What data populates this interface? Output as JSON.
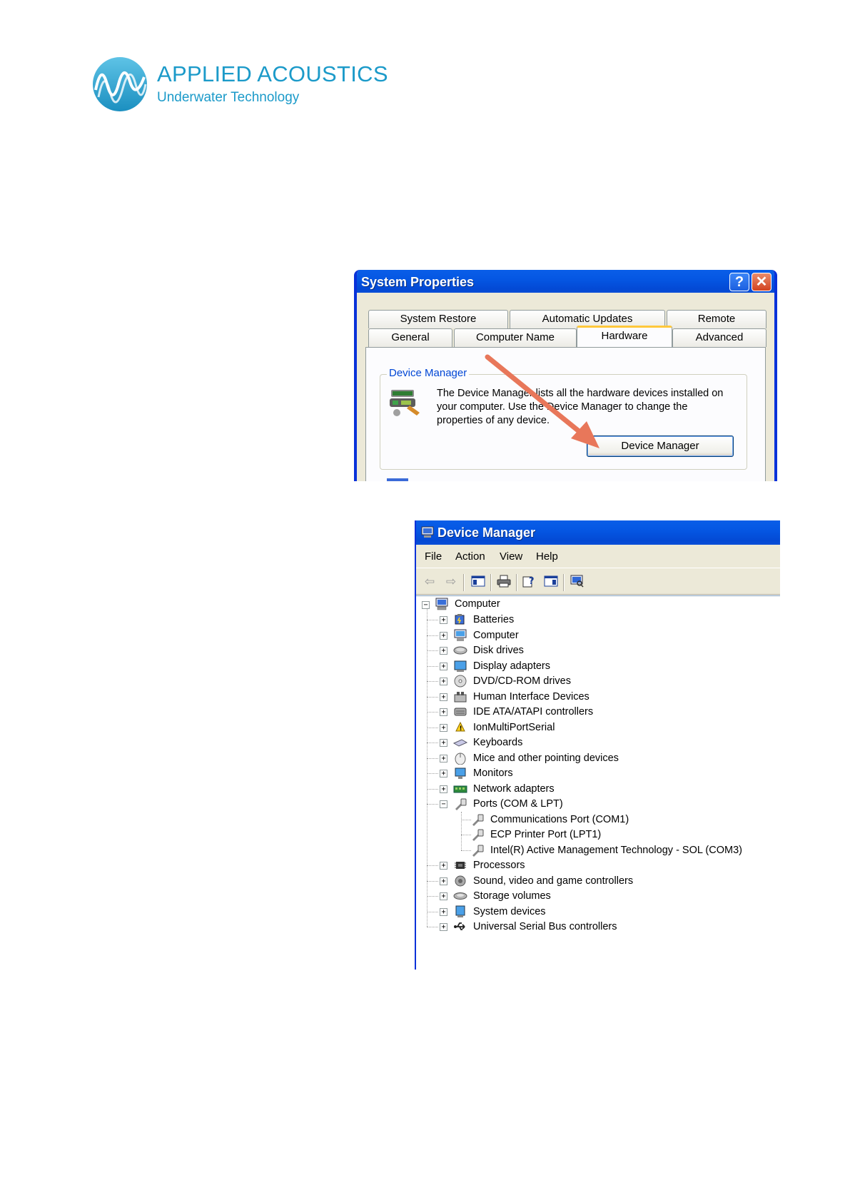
{
  "brand": {
    "title": "APPLIED ACOUSTICS",
    "subtitle": "Underwater Technology",
    "rule": "_____________________________________________",
    "color": "#1b9ac9"
  },
  "system_properties": {
    "title": "System Properties",
    "help_glyph": "?",
    "close_glyph": "✕",
    "tabs_row1": [
      "System Restore",
      "Automatic Updates",
      "Remote"
    ],
    "tabs_row2": [
      "General",
      "Computer Name",
      "Hardware",
      "Advanced"
    ],
    "active_tab": "Hardware",
    "group_label": "Device Manager",
    "description": "The Device Manager lists all the hardware devices installed on your computer. Use the Device Manager to change the properties of any device.",
    "button_label": "Device Manager",
    "arrow_color": "#e8775a"
  },
  "device_manager": {
    "title": "Device Manager",
    "menu": [
      "File",
      "Action",
      "View",
      "Help"
    ],
    "toolbar_icons": [
      "back-arrow-icon",
      "forward-arrow-icon",
      "show-hide-console-tree-icon",
      "print-icon",
      "properties-help-icon",
      "export-list-icon",
      "scan-hardware-icon"
    ],
    "root": "Computer",
    "categories": [
      {
        "label": "Batteries",
        "icon": "battery-icon",
        "expanded": false
      },
      {
        "label": "Computer",
        "icon": "computer-icon",
        "expanded": false
      },
      {
        "label": "Disk drives",
        "icon": "disk-drive-icon",
        "expanded": false
      },
      {
        "label": "Display adapters",
        "icon": "display-adapter-icon",
        "expanded": false
      },
      {
        "label": "DVD/CD-ROM drives",
        "icon": "cd-drive-icon",
        "expanded": false
      },
      {
        "label": "Human Interface Devices",
        "icon": "hid-icon",
        "expanded": false
      },
      {
        "label": "IDE ATA/ATAPI controllers",
        "icon": "ide-controller-icon",
        "expanded": false
      },
      {
        "label": "IonMultiPortSerial",
        "icon": "warning-port-icon",
        "expanded": false
      },
      {
        "label": "Keyboards",
        "icon": "keyboard-icon",
        "expanded": false
      },
      {
        "label": "Mice and other pointing devices",
        "icon": "mouse-icon",
        "expanded": false
      },
      {
        "label": "Monitors",
        "icon": "monitor-icon",
        "expanded": false
      },
      {
        "label": "Network adapters",
        "icon": "network-adapter-icon",
        "expanded": false
      },
      {
        "label": "Ports (COM & LPT)",
        "icon": "port-icon",
        "expanded": true,
        "children": [
          "Communications Port (COM1)",
          "ECP Printer Port (LPT1)",
          "Intel(R) Active Management Technology - SOL (COM3)"
        ]
      },
      {
        "label": "Processors",
        "icon": "processor-icon",
        "expanded": false
      },
      {
        "label": "Sound, video and game controllers",
        "icon": "sound-icon",
        "expanded": false
      },
      {
        "label": "Storage volumes",
        "icon": "storage-volume-icon",
        "expanded": false
      },
      {
        "label": "System devices",
        "icon": "system-device-icon",
        "expanded": false
      },
      {
        "label": "Universal Serial Bus controllers",
        "icon": "usb-icon",
        "expanded": false
      }
    ]
  }
}
